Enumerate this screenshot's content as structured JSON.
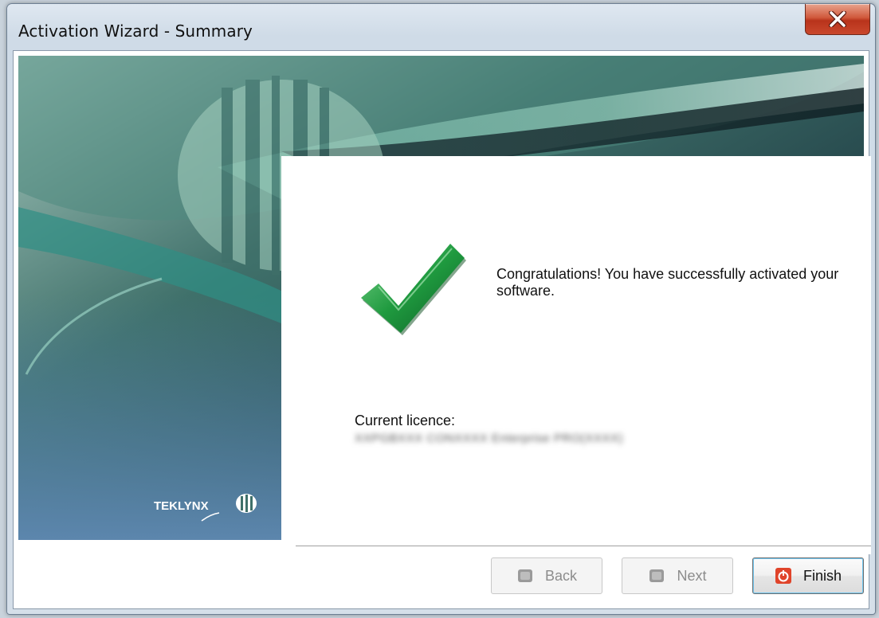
{
  "window": {
    "title": "Activation Wizard - Summary"
  },
  "banner": {
    "logo_text": "TEKLYNX"
  },
  "content": {
    "message": "Congratulations! You have successfully activated your software.",
    "licence_label": "Current licence:",
    "licence_value": "XXPGBXXX CONXXXX Enterprise PRO(XXXX)"
  },
  "buttons": {
    "back": "Back",
    "next": "Next",
    "finish": "Finish"
  },
  "icons": {
    "close": "close-icon",
    "check": "checkmark-icon",
    "back": "back-icon",
    "next": "next-icon",
    "finish": "power-icon"
  },
  "colors": {
    "check_green": "#1f9a3f",
    "finish_red": "#e0442a",
    "close_red": "#c9482c"
  }
}
